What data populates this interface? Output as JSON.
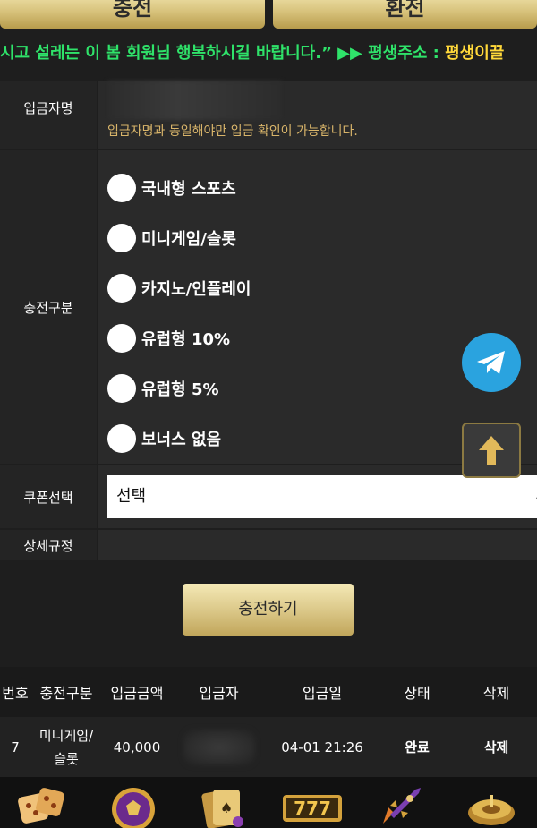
{
  "tabs": {
    "deposit": "충전",
    "withdraw": "환전"
  },
  "notice": {
    "text_green": "시고 설레는 이 봄 회원님 행복하시길 바랍니다.” ▶▶ 평생주소 : ",
    "text_yellow": "평생이끌"
  },
  "form": {
    "depositor_label": "입금자명",
    "depositor_hint": "입금자명과 동일해야만 입금 확인이 가능합니다.",
    "charge_type_label": "충전구분",
    "charge_types": [
      "국내형 스포츠",
      "미니게임/슬롯",
      "카지노/인플레이",
      "유럽형 10%",
      "유럽형 5%",
      "보너스 없음"
    ],
    "coupon_label": "쿠폰선택",
    "coupon_value": "선택",
    "rules_label": "상세규정",
    "submit_label": "충전하기"
  },
  "history": {
    "headers": [
      "번호",
      "충전구분",
      "입금금액",
      "입금자",
      "입금일",
      "상태",
      "삭제"
    ],
    "rows": [
      {
        "no": "7",
        "type": "미니게임/\n슬롯",
        "amount": "40,000",
        "date": "04-01 21:26",
        "status": "완료",
        "delete": "삭제"
      }
    ]
  },
  "colors": {
    "background": "#1e1e1e",
    "gold": "#d7c27b",
    "notice_green": "#2fe36a",
    "notice_yellow": "#ffd83a",
    "hint": "#d9b56a",
    "telegram": "#2aa3df"
  },
  "icons": {
    "bottom_nav": [
      "dice-icon",
      "soccer-ball-icon",
      "cards-icon",
      "slot-777-icon",
      "rocket-icon",
      "roulette-icon"
    ],
    "floating": [
      "telegram-icon",
      "arrow-up-icon"
    ]
  }
}
